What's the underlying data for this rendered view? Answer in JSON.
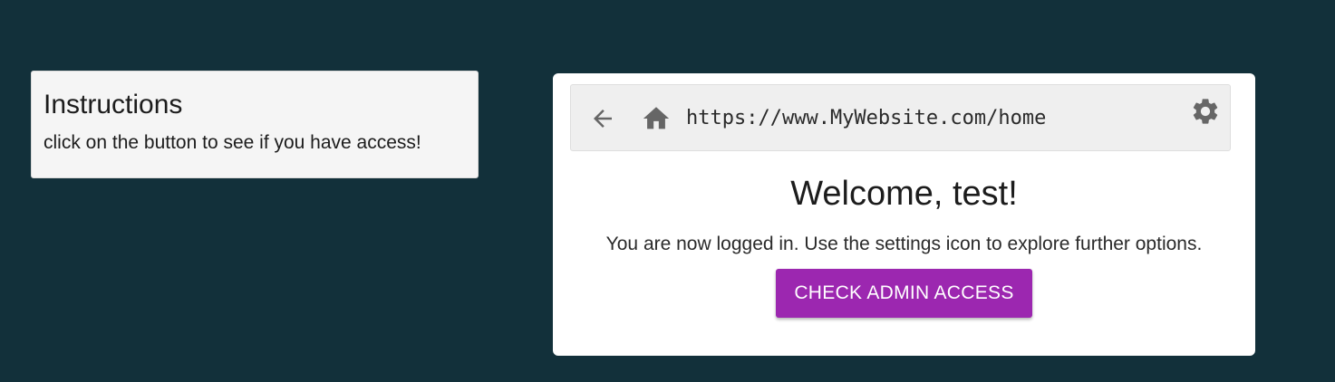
{
  "instructions": {
    "title": "Instructions",
    "text": "click on the button to see if you have access!"
  },
  "browser": {
    "url": "https://www.MyWebsite.com/home",
    "icons": {
      "back": "arrow-back-icon",
      "home": "home-icon",
      "settings": "gear-icon"
    }
  },
  "content": {
    "welcome": "Welcome, test!",
    "message": "You are now logged in. Use the settings icon to explore further options.",
    "admin_button_label": "CHECK ADMIN ACCESS"
  },
  "colors": {
    "page_background": "#12303a",
    "button": "#9c27b0",
    "icon": "#666666"
  }
}
